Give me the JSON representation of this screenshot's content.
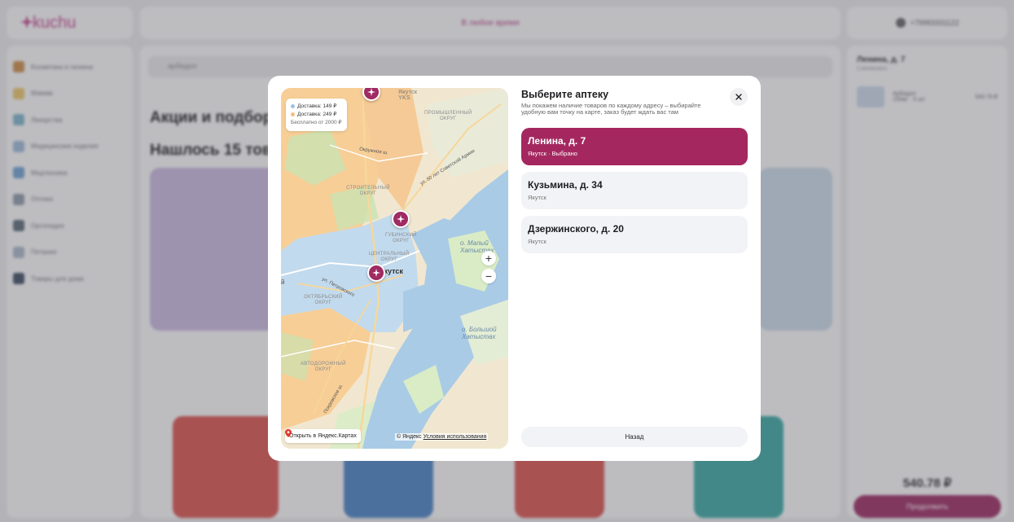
{
  "app": {
    "logo_text": "kuchu",
    "topbar_text": "В любое время",
    "user_phone": "+79993331122",
    "sidebar_items": [
      "Косметика и гигиена",
      "Мамам",
      "Лекарства",
      "Медицинские изделия",
      "Медтехника",
      "Оптика",
      "Ортопедия",
      "Питание",
      "Товары для дома"
    ],
    "search_value": "арбидол",
    "heading_promo": "Акции и подборки",
    "heading_found": "Нашлось 15 товаров",
    "cart": {
      "title": "Ленина, д. 7",
      "subtitle": "Самовывоз",
      "item_name": "Арбидол",
      "item_sub": "150мг · 5 шт",
      "item_price": "540.78 ₽",
      "total": "540.78 ₽",
      "checkout_label": "Продолжить"
    },
    "colors": {
      "brand": "#a4285f",
      "logo": "#c2418b"
    }
  },
  "modal": {
    "title": "Выберите аптеку",
    "description": "Мы покажем наличие товаров по каждому адресу – выбирайте удобную вам точку на карте, заказ будет ждать вас там",
    "close_icon": "close-icon",
    "pharmacies": [
      {
        "name": "Ленина, д. 7",
        "city": "Якутск · Выбрано",
        "selected": true
      },
      {
        "name": "Кузьмина, д. 34",
        "city": "Якутск",
        "selected": false
      },
      {
        "name": "Дзержинского, д. 20",
        "city": "Якутск",
        "selected": false
      }
    ],
    "back_label": "Назад"
  },
  "map": {
    "legend": {
      "delivery1": "Доставка: 149 ₽",
      "delivery2": "Доставка: 249 ₽",
      "free": "Бесплатно от 2000 ₽",
      "color1": "#9dc3e8",
      "color2": "#f5c07a"
    },
    "labels": {
      "airport": "Якутск",
      "airport_code": "YKS",
      "district_industrial_1": "Промышленный",
      "district_industrial_2": "округ",
      "district_builder_1": "Строительный",
      "district_builder_2": "округ",
      "district_gubinsky_1": "Губинский",
      "district_gubinsky_2": "округ",
      "district_central_1": "Центральный",
      "district_central_2": "округ",
      "district_october_1": "Октябрьский",
      "district_october_2": "округ",
      "district_auto_1": "Автодорожный",
      "district_auto_2": "округ",
      "city": "Якутск",
      "street_soviet": "ул. 50 лет Советской Армии",
      "street_ordzh": "Окружное ш.",
      "street_petrovsky": "ул. Петровского",
      "street_pokrovskoe": "Покровское ш.",
      "island_small_1": "о. Малый",
      "island_small_2": "Хатыстах",
      "island_big_1": "о. Большой",
      "island_big_2": "Хатыстах",
      "left_edge": "й"
    },
    "zoom_in": "+",
    "zoom_out": "−",
    "open_maps_label": "Открыть в Яндекс.Картах",
    "copyright": "© Яндекс",
    "terms": "Условия использования"
  }
}
